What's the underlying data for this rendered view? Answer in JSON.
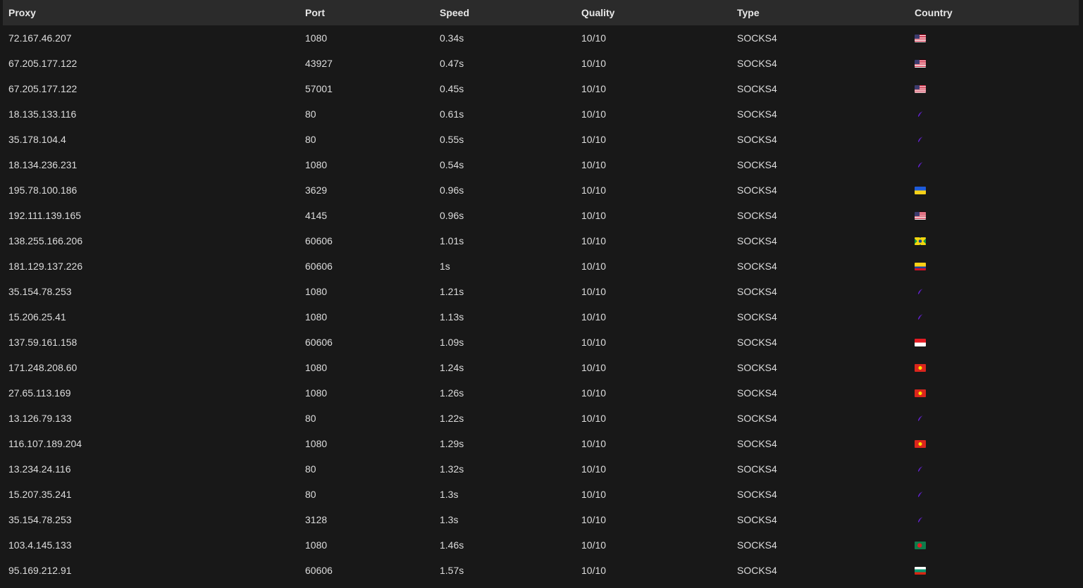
{
  "table": {
    "columns": [
      "Proxy",
      "Port",
      "Speed",
      "Quality",
      "Type",
      "Country"
    ],
    "rows": [
      {
        "proxy": "72.167.46.207",
        "port": "1080",
        "speed": "0.34s",
        "quality": "10/10",
        "type": "SOCKS4",
        "country_flag": "us-flag-icon"
      },
      {
        "proxy": "67.205.177.122",
        "port": "43927",
        "speed": "0.47s",
        "quality": "10/10",
        "type": "SOCKS4",
        "country_flag": "us-flag-icon"
      },
      {
        "proxy": "67.205.177.122",
        "port": "57001",
        "speed": "0.45s",
        "quality": "10/10",
        "type": "SOCKS4",
        "country_flag": "us-flag-icon"
      },
      {
        "proxy": "18.135.133.116",
        "port": "80",
        "speed": "0.61s",
        "quality": "10/10",
        "type": "SOCKS4",
        "country_flag": "unknown-flag-icon"
      },
      {
        "proxy": "35.178.104.4",
        "port": "80",
        "speed": "0.55s",
        "quality": "10/10",
        "type": "SOCKS4",
        "country_flag": "unknown-flag-icon"
      },
      {
        "proxy": "18.134.236.231",
        "port": "1080",
        "speed": "0.54s",
        "quality": "10/10",
        "type": "SOCKS4",
        "country_flag": "unknown-flag-icon"
      },
      {
        "proxy": "195.78.100.186",
        "port": "3629",
        "speed": "0.96s",
        "quality": "10/10",
        "type": "SOCKS4",
        "country_flag": "ua-flag-icon"
      },
      {
        "proxy": "192.111.139.165",
        "port": "4145",
        "speed": "0.96s",
        "quality": "10/10",
        "type": "SOCKS4",
        "country_flag": "us-flag-icon"
      },
      {
        "proxy": "138.255.166.206",
        "port": "60606",
        "speed": "1.01s",
        "quality": "10/10",
        "type": "SOCKS4",
        "country_flag": "br-flag-icon"
      },
      {
        "proxy": "181.129.137.226",
        "port": "60606",
        "speed": "1s",
        "quality": "10/10",
        "type": "SOCKS4",
        "country_flag": "co-flag-icon"
      },
      {
        "proxy": "35.154.78.253",
        "port": "1080",
        "speed": "1.21s",
        "quality": "10/10",
        "type": "SOCKS4",
        "country_flag": "unknown-flag-icon"
      },
      {
        "proxy": "15.206.25.41",
        "port": "1080",
        "speed": "1.13s",
        "quality": "10/10",
        "type": "SOCKS4",
        "country_flag": "unknown-flag-icon"
      },
      {
        "proxy": "137.59.161.158",
        "port": "60606",
        "speed": "1.09s",
        "quality": "10/10",
        "type": "SOCKS4",
        "country_flag": "id-flag-icon"
      },
      {
        "proxy": "171.248.208.60",
        "port": "1080",
        "speed": "1.24s",
        "quality": "10/10",
        "type": "SOCKS4",
        "country_flag": "vn-flag-icon"
      },
      {
        "proxy": "27.65.113.169",
        "port": "1080",
        "speed": "1.26s",
        "quality": "10/10",
        "type": "SOCKS4",
        "country_flag": "vn-flag-icon"
      },
      {
        "proxy": "13.126.79.133",
        "port": "80",
        "speed": "1.22s",
        "quality": "10/10",
        "type": "SOCKS4",
        "country_flag": "unknown-flag-icon"
      },
      {
        "proxy": "116.107.189.204",
        "port": "1080",
        "speed": "1.29s",
        "quality": "10/10",
        "type": "SOCKS4",
        "country_flag": "vn-flag-icon"
      },
      {
        "proxy": "13.234.24.116",
        "port": "80",
        "speed": "1.32s",
        "quality": "10/10",
        "type": "SOCKS4",
        "country_flag": "unknown-flag-icon"
      },
      {
        "proxy": "15.207.35.241",
        "port": "80",
        "speed": "1.3s",
        "quality": "10/10",
        "type": "SOCKS4",
        "country_flag": "unknown-flag-icon"
      },
      {
        "proxy": "35.154.78.253",
        "port": "3128",
        "speed": "1.3s",
        "quality": "10/10",
        "type": "SOCKS4",
        "country_flag": "unknown-flag-icon"
      },
      {
        "proxy": "103.4.145.133",
        "port": "1080",
        "speed": "1.46s",
        "quality": "10/10",
        "type": "SOCKS4",
        "country_flag": "bd-flag-icon"
      },
      {
        "proxy": "95.169.212.91",
        "port": "60606",
        "speed": "1.57s",
        "quality": "10/10",
        "type": "SOCKS4",
        "country_flag": "bg-flag-icon"
      }
    ]
  },
  "colors": {
    "background": "#181818",
    "header_background": "#2b2b2b",
    "text": "#dddddd",
    "unknown_flag_accent": "#7b2cff"
  }
}
